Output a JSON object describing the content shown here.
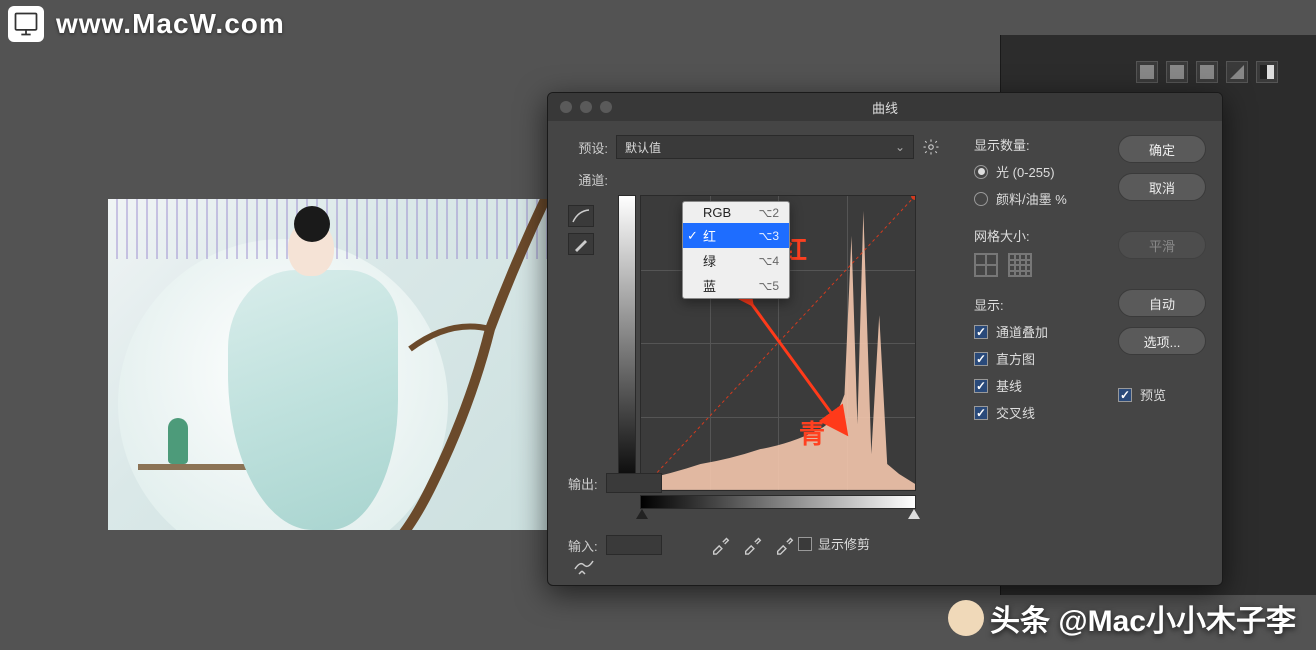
{
  "watermark_top": "www.MacW.com",
  "watermark_bottom": "头条 @Mac小小木子李",
  "dialog": {
    "title": "曲线",
    "preset_label": "预设:",
    "preset_value": "默认值",
    "channel_label": "通道:",
    "channel_menu": [
      {
        "label": "RGB",
        "shortcut": "⌥2",
        "checked": false,
        "hl": false
      },
      {
        "label": "红",
        "shortcut": "⌥3",
        "checked": true,
        "hl": true
      },
      {
        "label": "绿",
        "shortcut": "⌥4",
        "checked": false,
        "hl": false
      },
      {
        "label": "蓝",
        "shortcut": "⌥5",
        "checked": false,
        "hl": false
      }
    ],
    "output_label": "输出:",
    "input_label": "输入:",
    "show_clip": "显示修剪",
    "annot_up": "红",
    "annot_down": "青"
  },
  "options": {
    "show_amount": "显示数量:",
    "light": "光 (0-255)",
    "pigment": "颜料/油墨 %",
    "grid_size": "网格大小:",
    "show": "显示:",
    "overlay": "通道叠加",
    "histogram": "直方图",
    "baseline": "基线",
    "intersect": "交叉线"
  },
  "buttons": {
    "ok": "确定",
    "cancel": "取消",
    "smooth": "平滑",
    "auto": "自动",
    "more": "选项...",
    "preview": "预览"
  }
}
